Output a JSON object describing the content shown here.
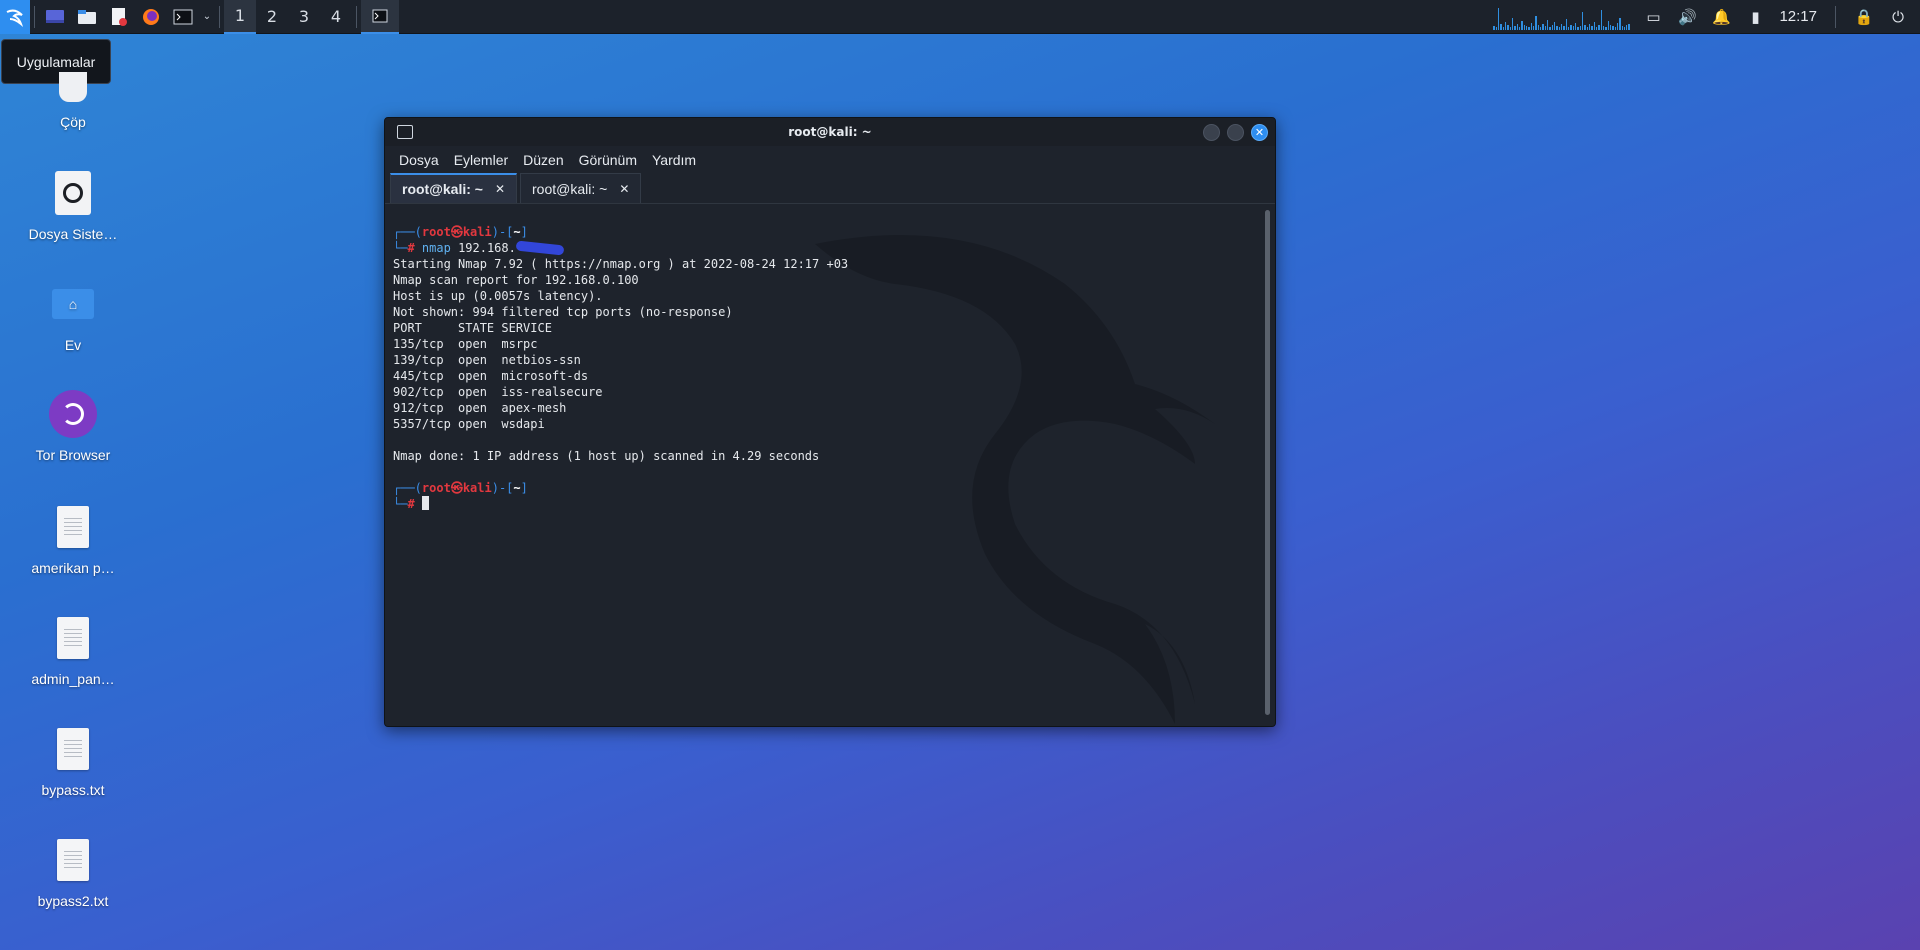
{
  "taskbar": {
    "workspaces": [
      "1",
      "2",
      "3",
      "4"
    ],
    "active_workspace": "1",
    "clock": "12:17",
    "accent": "#3b8ee8"
  },
  "tooltip": {
    "text": "Uygulamalar"
  },
  "desktop_icons": [
    {
      "label": "Çöp",
      "icon": "trash-icon"
    },
    {
      "label": "Dosya Siste…",
      "icon": "drive-icon"
    },
    {
      "label": "Ev",
      "icon": "home-folder-icon"
    },
    {
      "label": "Tor Browser",
      "icon": "tor-browser-icon"
    },
    {
      "label": "amerikan p…",
      "icon": "text-file-icon"
    },
    {
      "label": "admin_pan…",
      "icon": "text-file-icon"
    },
    {
      "label": "bypass.txt",
      "icon": "text-file-icon"
    },
    {
      "label": "bypass2.txt",
      "icon": "text-file-icon"
    }
  ],
  "window": {
    "title": "root@kali: ~",
    "menu": [
      "Dosya",
      "Eylemler",
      "Düzen",
      "Görünüm",
      "Yardım"
    ],
    "tabs": [
      {
        "label": "root@kali: ~",
        "active": true
      },
      {
        "label": "root@kali: ~",
        "active": false
      }
    ]
  },
  "terminal": {
    "prompt_user": "root",
    "prompt_at": "㉿",
    "prompt_host": "kali",
    "prompt_dir": "~",
    "command": "nmap",
    "command_arg": "192.168.",
    "output": [
      "Starting Nmap 7.92 ( https://nmap.org ) at 2022-08-24 12:17 +03",
      "Nmap scan report for 192.168.0.100",
      "Host is up (0.0057s latency).",
      "Not shown: 994 filtered tcp ports (no-response)",
      "PORT     STATE SERVICE",
      "135/tcp  open  msrpc",
      "139/tcp  open  netbios-ssn",
      "445/tcp  open  microsoft-ds",
      "902/tcp  open  iss-realsecure",
      "912/tcp  open  apex-mesh",
      "5357/tcp open  wsdapi",
      "",
      "Nmap done: 1 IP address (1 host up) scanned in 4.29 seconds"
    ]
  }
}
